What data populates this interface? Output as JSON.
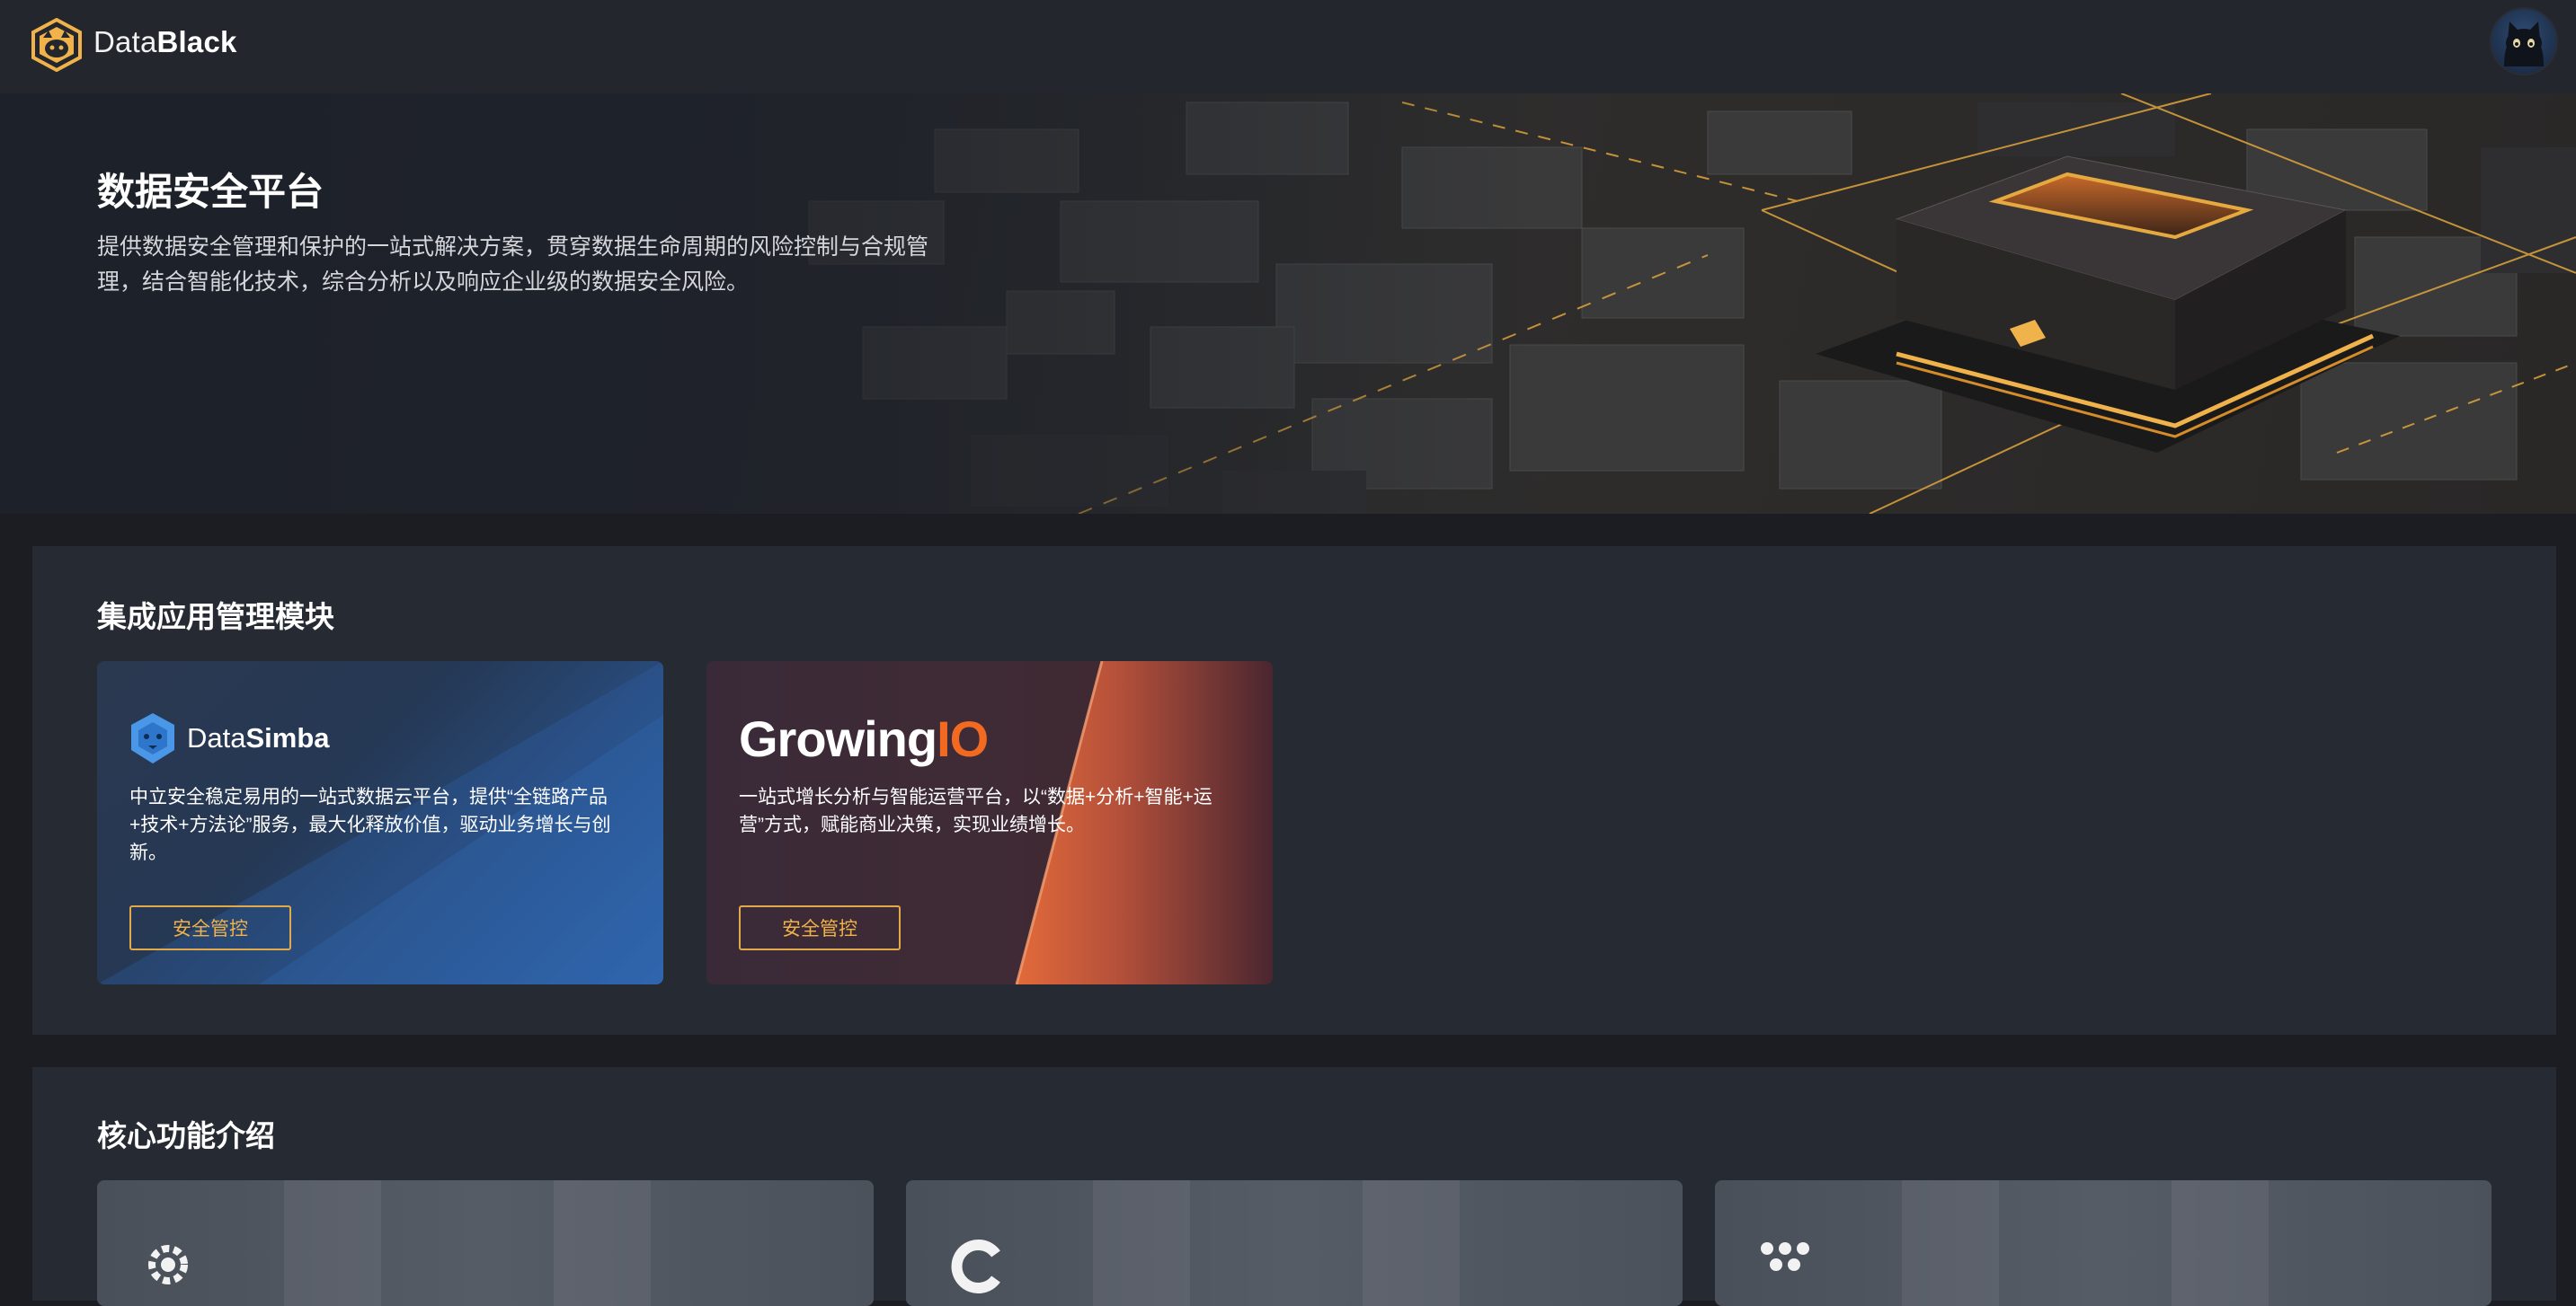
{
  "header": {
    "brand_prefix": "Data",
    "brand_suffix": "Black",
    "logo_icon": "cat-shield-logo",
    "avatar_icon": "cat-avatar"
  },
  "hero": {
    "title": "数据安全平台",
    "description": "提供数据安全管理和保护的一站式解决方案，贯穿数据生命周期的风险控制与合规管理，结合智能化技术，综合分析以及响应企业级的数据安全风险。"
  },
  "integrations": {
    "title": "集成应用管理模块",
    "cards": [
      {
        "logo_prefix": "Data",
        "logo_suffix": "Simba",
        "description": "中立安全稳定易用的一站式数据云平台，提供“全链路产品+技术+方法论”服务，最大化释放价值，驱动业务增长与创新。",
        "button_label": "安全管控"
      },
      {
        "logo_prefix": "Growing",
        "logo_suffix": "IO",
        "description": "一站式增长分析与智能运营平台，以“数据+分析+智能+运营”方式，赋能商业决策，实现业绩增长。",
        "button_label": "安全管控"
      }
    ]
  },
  "core_features": {
    "title": "核心功能介绍",
    "icons": [
      "gear-icon",
      "c-ring-icon",
      "dots-icon"
    ]
  },
  "colors": {
    "accent": "#f0b24a",
    "growingio_orange": "#f26a22",
    "background": "#1b1d22",
    "panel": "#262a32"
  }
}
